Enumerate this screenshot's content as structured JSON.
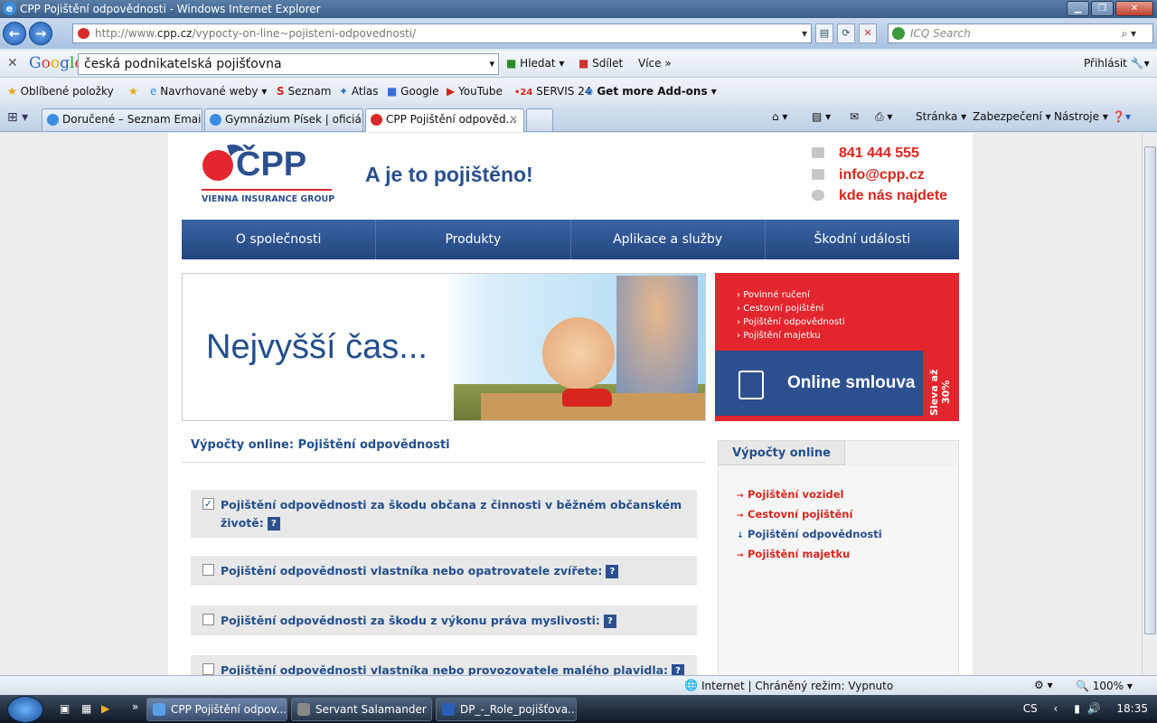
{
  "window": {
    "title": "CPP Pojištění odpovědnosti - Windows Internet Explorer"
  },
  "address": {
    "url_prefix": "http://www.",
    "url_domain": "cpp.cz",
    "url_path": "/vypocty-on-line~pojisteni-odpovednosti/",
    "search_placeholder": "ICQ Search"
  },
  "googlebar": {
    "logo": "Google",
    "query": "česká podnikatelská pojišťovna",
    "hledat": "Hledat",
    "sdilet": "Sdílet",
    "vice": "Více",
    "prihlasit": "Přihlásit"
  },
  "favorites": {
    "items": [
      "Oblíbené položky",
      "Navrhované weby",
      "Seznam",
      "Atlas",
      "Google",
      "YouTube",
      "SERVIS 24",
      "Get more Add-ons"
    ],
    "servis_prefix": "•24"
  },
  "tabs": [
    "Doručené – Seznam Email",
    "Gymnázium Písek | oficiál...",
    "CPP Pojištění odpověd..."
  ],
  "commandbar": {
    "stranka": "Stránka",
    "zabezpeceni": "Zabezpečení",
    "nastroje": "Nástroje"
  },
  "site": {
    "logo_text": "ČPP",
    "logo_sub": "VIENNA INSURANCE GROUP",
    "tagline": "A je to pojištěno!",
    "phone": "841 444 555",
    "email": "info@cpp.cz",
    "location": "kde nás najdete",
    "nav": [
      "O společnosti",
      "Produkty",
      "Aplikace a služby",
      "Škodní události"
    ],
    "banner_slogan": "Nejvyšší čas...",
    "promo_links": [
      "Povinné ručení",
      "Cestovní pojištění",
      "Pojištění odpovědnosti",
      "Pojištění majetku"
    ],
    "promo_online": "Online smlouva",
    "promo_sleva": "Sleva až 30%",
    "heading": "Výpočty online: Pojištění odpovědnosti",
    "options": [
      {
        "label": "Pojištění odpovědnosti za škodu občana z činnosti v běžném občanském životě:",
        "checked": true
      },
      {
        "label": "Pojištění odpovědnosti vlastníka nebo opatrovatele zvířete:",
        "checked": false
      },
      {
        "label": "Pojištění odpovědnosti za škodu z výkonu práva myslivosti:",
        "checked": false
      },
      {
        "label": "Pojištění odpovědnosti vlastníka nebo provozovatele malého plavidla:",
        "checked": false
      }
    ],
    "side_tab": "Výpočty online",
    "side_links": [
      "Pojištění vozidel",
      "Cestovní pojištění",
      "Pojištění odpovědnosti",
      "Pojištění majetku"
    ]
  },
  "status": {
    "zone": "Internet | Chráněný režim: Vypnuto",
    "zoom": "100%"
  },
  "taskbar": {
    "items": [
      "CPP Pojištění odpov...",
      "Servant Salamander",
      "DP_-_Role_pojišťova..."
    ],
    "lang": "CS",
    "time": "18:35"
  },
  "colors": {
    "brand_blue": "#234f8c",
    "brand_red": "#e3262d"
  }
}
